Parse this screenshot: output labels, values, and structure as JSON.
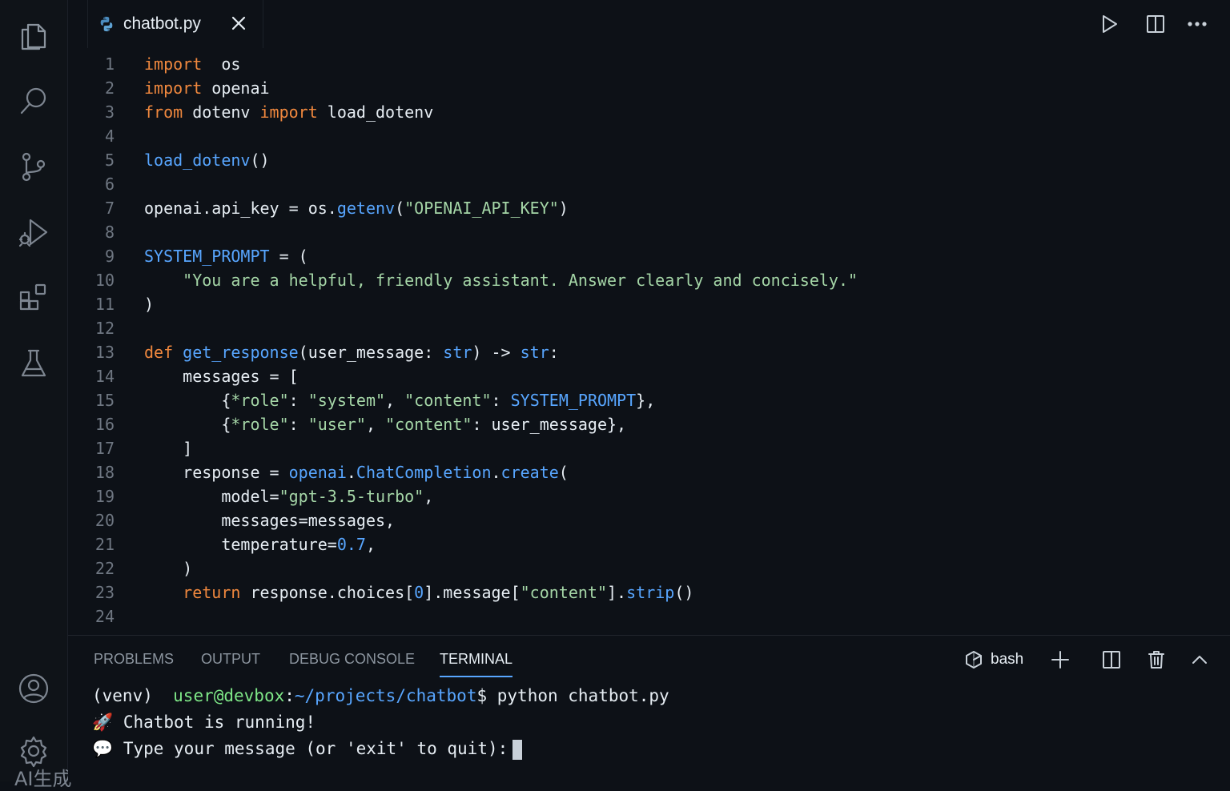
{
  "activity_bar": {
    "items": [
      "files-icon",
      "search-icon",
      "source-control-icon",
      "run-debug-icon",
      "extensions-icon",
      "testing-icon",
      "account-icon",
      "settings-icon"
    ],
    "footer_text": "AI生成"
  },
  "tab": {
    "label": "chatbot.py",
    "file_icon": "python-icon"
  },
  "editor": {
    "lines": [
      {
        "n": "1",
        "segs": [
          [
            "kw",
            "import"
          ],
          [
            "",
            "  os"
          ]
        ]
      },
      {
        "n": "2",
        "segs": [
          [
            "kw",
            "import"
          ],
          [
            "",
            " openai"
          ]
        ]
      },
      {
        "n": "3",
        "segs": [
          [
            "kw",
            "from"
          ],
          [
            "",
            " dotenv "
          ],
          [
            "kw",
            "import"
          ],
          [
            "",
            " load_dotenv"
          ]
        ]
      },
      {
        "n": "4",
        "segs": []
      },
      {
        "n": "5",
        "segs": [
          [
            "fn",
            "load_dotenv"
          ],
          [
            "",
            "()"
          ]
        ]
      },
      {
        "n": "6",
        "segs": []
      },
      {
        "n": "7",
        "segs": [
          [
            "",
            "openai.api_key = os."
          ],
          [
            "fn",
            "getenv"
          ],
          [
            "",
            "("
          ],
          [
            "str",
            "\"OPENAI_API_KEY\""
          ],
          [
            "",
            ")"
          ]
        ]
      },
      {
        "n": "8",
        "segs": []
      },
      {
        "n": "9",
        "segs": [
          [
            "cls",
            "SYSTEM_PROMPT"
          ],
          [
            "",
            " = ("
          ]
        ]
      },
      {
        "n": "10",
        "segs": [
          [
            "",
            "    "
          ],
          [
            "str",
            "\"You are a helpful, friendly assistant. Answer clearly and concisely.\""
          ]
        ]
      },
      {
        "n": "11",
        "segs": [
          [
            "",
            ")"
          ]
        ]
      },
      {
        "n": "12",
        "segs": []
      },
      {
        "n": "13",
        "segs": [
          [
            "kw",
            "def"
          ],
          [
            "",
            " "
          ],
          [
            "fn",
            "get_response"
          ],
          [
            "",
            "(user_message: "
          ],
          [
            "cls",
            "str"
          ],
          [
            "",
            ") -> "
          ],
          [
            "cls",
            "str"
          ],
          [
            "",
            ":"
          ]
        ]
      },
      {
        "n": "14",
        "segs": [
          [
            "",
            "    messages = ["
          ]
        ]
      },
      {
        "n": "15",
        "segs": [
          [
            "",
            "        {"
          ],
          [
            "str",
            "*role\""
          ],
          [
            "",
            ": "
          ],
          [
            "str",
            "\"system\""
          ],
          [
            "",
            ", "
          ],
          [
            "str",
            "\"content\""
          ],
          [
            "",
            ": "
          ],
          [
            "cls",
            "SYSTEM_PROMPT"
          ],
          [
            "",
            "},"
          ]
        ]
      },
      {
        "n": "16",
        "segs": [
          [
            "",
            "        {"
          ],
          [
            "str",
            "*role\""
          ],
          [
            "",
            ": "
          ],
          [
            "str",
            "\"user\""
          ],
          [
            "",
            ", "
          ],
          [
            "str",
            "\"content\""
          ],
          [
            "",
            ": user_message},"
          ]
        ]
      },
      {
        "n": "17",
        "segs": [
          [
            "",
            "    ]"
          ]
        ]
      },
      {
        "n": "18",
        "segs": [
          [
            "",
            "    response = "
          ],
          [
            "fn",
            "openai"
          ],
          [
            "",
            "."
          ],
          [
            "cls",
            "ChatCompletion"
          ],
          [
            "",
            "."
          ],
          [
            "fn",
            "create"
          ],
          [
            "",
            "("
          ]
        ]
      },
      {
        "n": "19",
        "segs": [
          [
            "",
            "        model="
          ],
          [
            "str",
            "\"gpt-3.5-turbo\""
          ],
          [
            "",
            ","
          ]
        ]
      },
      {
        "n": "20",
        "segs": [
          [
            "",
            "        messages=messages,"
          ]
        ]
      },
      {
        "n": "21",
        "segs": [
          [
            "",
            "        temperature="
          ],
          [
            "num",
            "0.7"
          ],
          [
            "",
            ","
          ]
        ]
      },
      {
        "n": "22",
        "segs": [
          [
            "",
            "    )"
          ]
        ]
      },
      {
        "n": "23",
        "segs": [
          [
            "",
            "    "
          ],
          [
            "kw",
            "return"
          ],
          [
            "",
            " response.choices["
          ],
          [
            "num",
            "0"
          ],
          [
            "",
            "].message["
          ],
          [
            "str",
            "\"content\""
          ],
          [
            "",
            "]."
          ],
          [
            "fn",
            "strip"
          ],
          [
            "",
            "()"
          ]
        ]
      },
      {
        "n": "24",
        "segs": []
      }
    ]
  },
  "panel": {
    "tabs": [
      "PROBLEMS",
      "OUTPUT",
      "DEBUG CONSOLE",
      "TERMINAL"
    ],
    "active_tab": "TERMINAL",
    "shell_label": "bash"
  },
  "terminal": {
    "prompt_env": "(venv)",
    "prompt_user": "user@devbox",
    "prompt_path": "~/projects/chatbot",
    "command": "python chatbot.py",
    "line2_emoji": "🚀",
    "line2": "Chatbot is running!",
    "line3_emoji": "💬",
    "line3": "Type your message (or 'exit' to quit):"
  }
}
